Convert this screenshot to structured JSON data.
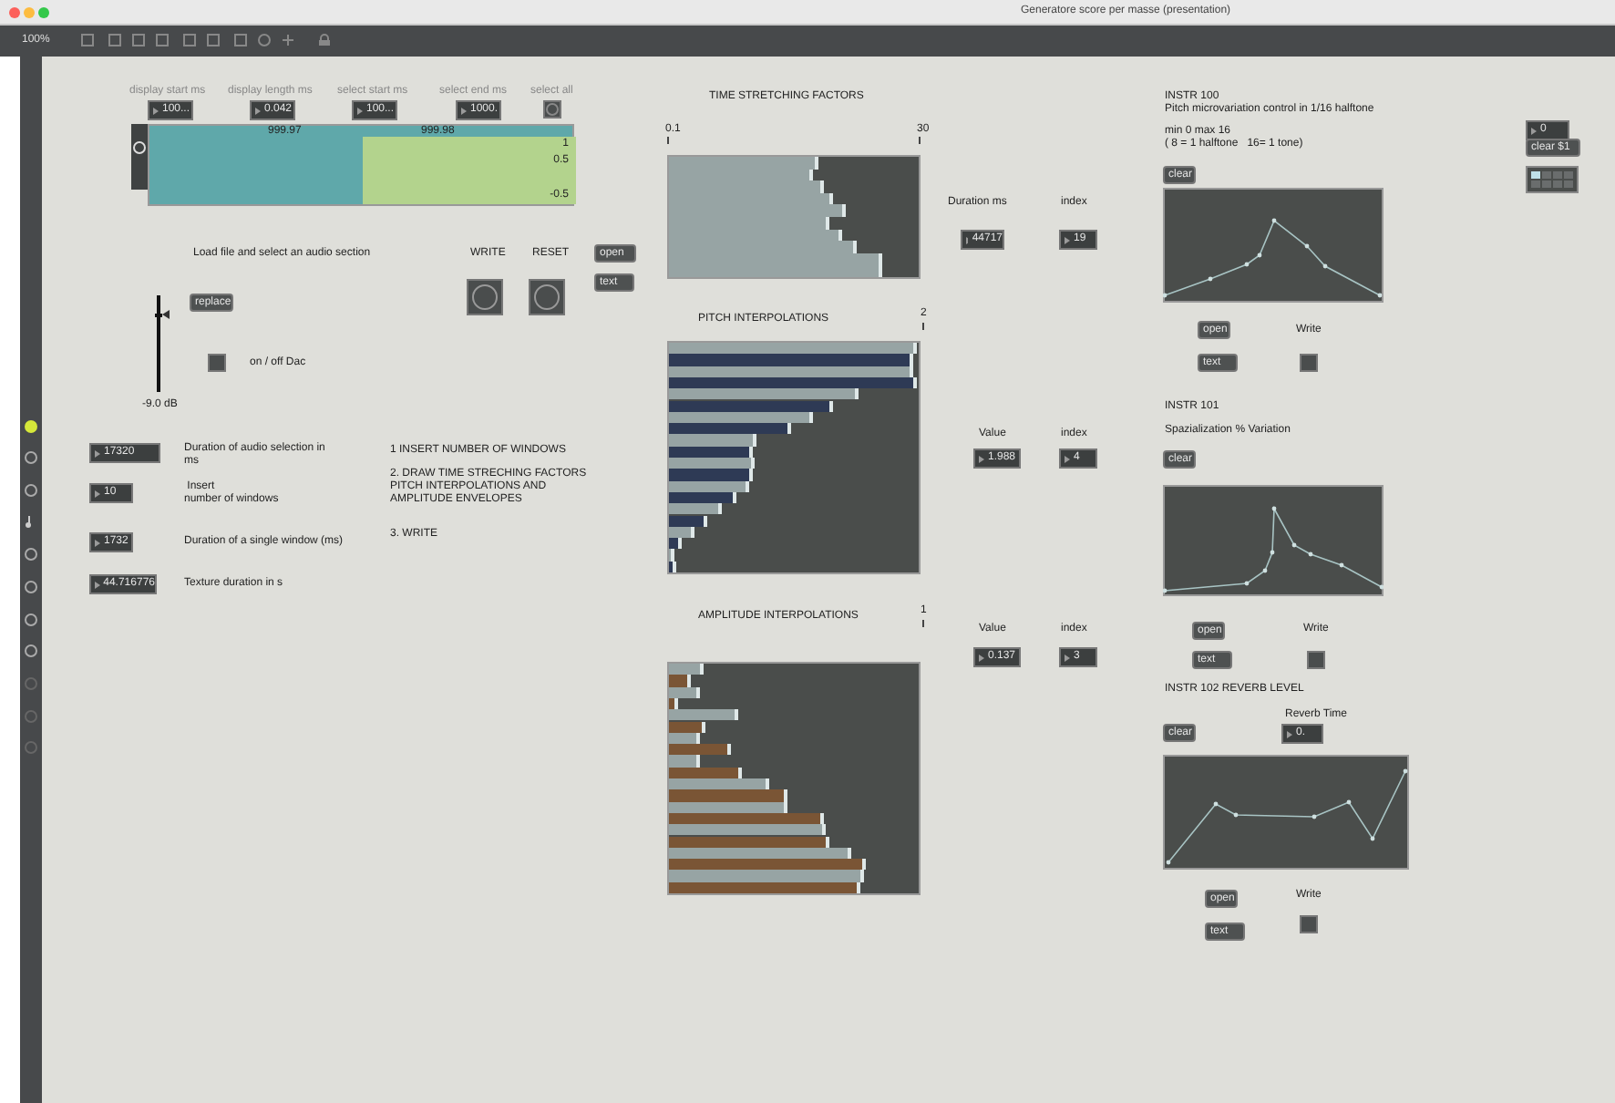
{
  "window": {
    "title": "Generatore score per masse (presentation)",
    "zoom": "100%"
  },
  "waveform_fields": [
    {
      "label": "display start ms",
      "value": "100..."
    },
    {
      "label": "display length ms",
      "value": "0.042"
    },
    {
      "label": "select start ms",
      "value": "100..."
    },
    {
      "label": "select end ms",
      "value": "1000."
    }
  ],
  "select_all": {
    "label": "select all"
  },
  "waveform": {
    "markers": [
      "999.97",
      "999.98"
    ],
    "scale": [
      "1",
      "0.5",
      "-0.5"
    ]
  },
  "load_label": "Load file and select an audio section",
  "bangs": [
    {
      "label": "WRITE"
    },
    {
      "label": "RESET"
    }
  ],
  "file_buttons": [
    "open",
    "text"
  ],
  "replace_button": "replace",
  "gain": {
    "level": 0.8,
    "reading": "-9.0 dB"
  },
  "dac": {
    "label": "on / off Dac",
    "checked": false
  },
  "parameters": [
    {
      "value": "17320",
      "label": "Duration of audio selection in\nms"
    },
    {
      "value": "10",
      "label": " Insert\nnumber of windows"
    },
    {
      "value": "1732",
      "label": "Duration of a single window (ms)"
    },
    {
      "value": "44.716776",
      "label": "Texture duration in s"
    }
  ],
  "instructions": [
    "1 INSERT NUMBER OF WINDOWS",
    "2. DRAW TIME STRECHING FACTORS\nPITCH INTERPOLATIONS AND\nAMPLITUDE ENVELOPES",
    "3. WRITE"
  ],
  "sliders": [
    {
      "title": "TIME STRETCHING FACTORS",
      "min": "0.1",
      "max": "30",
      "field_labels": [
        "Duration ms",
        "index"
      ],
      "values": [
        "44717",
        "19"
      ],
      "bars": [
        {
          "level": 0.6,
          "color": "#97a4a4"
        },
        {
          "level": 0.58,
          "color": "#97a4a4"
        },
        {
          "level": 0.62,
          "color": "#97a4a4"
        },
        {
          "level": 0.66,
          "color": "#97a4a4"
        },
        {
          "level": 0.71,
          "color": "#97a4a4"
        },
        {
          "level": 0.64,
          "color": "#97a4a4"
        },
        {
          "level": 0.69,
          "color": "#97a4a4"
        },
        {
          "level": 0.75,
          "color": "#97a4a4"
        },
        {
          "level": 0.855,
          "color": "#97a4a4"
        },
        {
          "level": 0.855,
          "color": "#97a4a4"
        }
      ]
    },
    {
      "title": "PITCH INTERPOLATIONS",
      "max": "2",
      "field_labels": [
        "Value",
        "index"
      ],
      "values": [
        "1.988",
        "4"
      ],
      "bars": [
        {
          "level": 0.995,
          "color": "#97a4a4"
        },
        {
          "level": 0.98,
          "color": "#2e3a55"
        },
        {
          "level": 0.976,
          "color": "#97a4a4"
        },
        {
          "level": 0.995,
          "color": "#2e3a55"
        },
        {
          "level": 0.76,
          "color": "#97a4a4"
        },
        {
          "level": 0.66,
          "color": "#2e3a55"
        },
        {
          "level": 0.575,
          "color": "#97a4a4"
        },
        {
          "level": 0.49,
          "color": "#2e3a55"
        },
        {
          "level": 0.347,
          "color": "#97a4a4"
        },
        {
          "level": 0.335,
          "color": "#2e3a55"
        },
        {
          "level": 0.34,
          "color": "#97a4a4"
        },
        {
          "level": 0.335,
          "color": "#2e3a55"
        },
        {
          "level": 0.32,
          "color": "#97a4a4"
        },
        {
          "level": 0.27,
          "color": "#2e3a55"
        },
        {
          "level": 0.214,
          "color": "#97a4a4"
        },
        {
          "level": 0.15,
          "color": "#2e3a55"
        },
        {
          "level": 0.104,
          "color": "#97a4a4"
        },
        {
          "level": 0.05,
          "color": "#2e3a55"
        },
        {
          "level": 0.024,
          "color": "#97a4a4"
        },
        {
          "level": 0.03,
          "color": "#2e3a55"
        }
      ]
    },
    {
      "title": "AMPLITUDE INTERPOLATIONS",
      "max": "1",
      "field_labels": [
        "Value",
        "index"
      ],
      "values": [
        "0.137",
        "3"
      ],
      "bars": [
        {
          "level": 0.14,
          "color": "#97a4a4"
        },
        {
          "level": 0.084,
          "color": "#7a5535"
        },
        {
          "level": 0.125,
          "color": "#97a4a4"
        },
        {
          "level": 0.039,
          "color": "#7a5535"
        },
        {
          "level": 0.28,
          "color": "#97a4a4"
        },
        {
          "level": 0.145,
          "color": "#7a5535"
        },
        {
          "level": 0.125,
          "color": "#97a4a4"
        },
        {
          "level": 0.25,
          "color": "#7a5535"
        },
        {
          "level": 0.125,
          "color": "#97a4a4"
        },
        {
          "level": 0.29,
          "color": "#7a5535"
        },
        {
          "level": 0.4,
          "color": "#97a4a4"
        },
        {
          "level": 0.475,
          "color": "#7a5535"
        },
        {
          "level": 0.475,
          "color": "#97a4a4"
        },
        {
          "level": 0.62,
          "color": "#7a5535"
        },
        {
          "level": 0.63,
          "color": "#97a4a4"
        },
        {
          "level": 0.64,
          "color": "#7a5535"
        },
        {
          "level": 0.73,
          "color": "#97a4a4"
        },
        {
          "level": 0.79,
          "color": "#7a5535"
        },
        {
          "level": 0.78,
          "color": "#97a4a4"
        },
        {
          "level": 0.77,
          "color": "#7a5535"
        }
      ]
    }
  ],
  "instruments": [
    {
      "title": "INSTR 100",
      "lines": [
        "Pitch microvariation control in 1/16 halftone",
        "min 0 max 16",
        "( 8 = 1 halftone   16= 1 tone)"
      ],
      "clear": "clear",
      "open": "open",
      "text": "text",
      "write_label": "Write",
      "write_checked": false
    },
    {
      "title": "INSTR 101",
      "lines": [
        "Spazialization % Variation"
      ],
      "clear": "clear",
      "open": "open",
      "text": "text",
      "write_label": "Write",
      "write_checked": false
    },
    {
      "title": "INSTR 102 REVERB LEVEL",
      "reverb_label": "Reverb Time",
      "reverb_value": "0.",
      "clear": "clear",
      "open": "open",
      "text": "text",
      "write_label": "Write",
      "write_checked": false
    }
  ],
  "preset": {
    "value": "0",
    "clear": "clear $1",
    "cells": [
      {
        "selected": true
      },
      {
        "selected": false
      },
      {
        "selected": false
      },
      {
        "selected": false
      },
      {
        "selected": false
      },
      {
        "selected": false
      },
      {
        "selected": false
      },
      {
        "selected": false
      }
    ]
  }
}
